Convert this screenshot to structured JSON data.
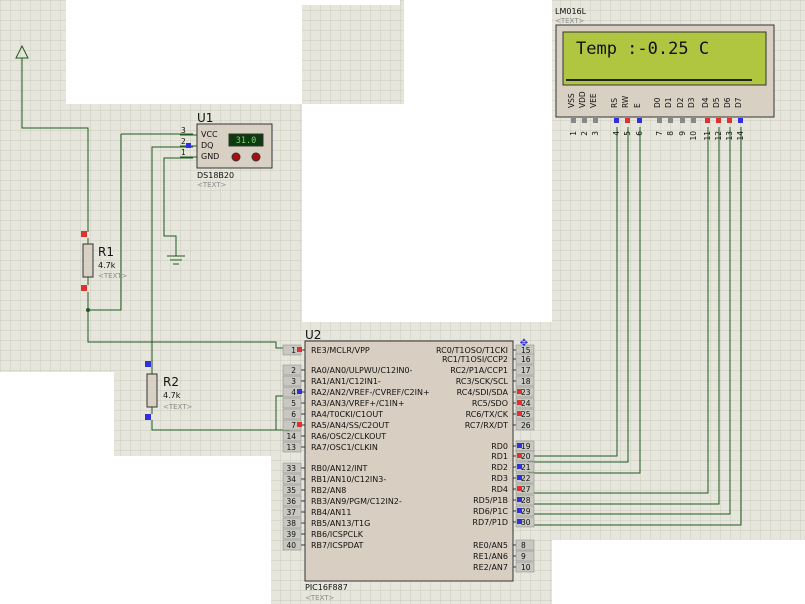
{
  "lcd": {
    "name": "LM016L",
    "placeholder": "<TEXT>",
    "display": "Temp :-0.25 C",
    "pin_labels": [
      "VSS",
      "VDD",
      "VEE",
      "RS",
      "RW",
      "E",
      "D0",
      "D1",
      "D2",
      "D3",
      "D4",
      "D5",
      "D6",
      "D7"
    ],
    "pin_numbers": [
      "1",
      "2",
      "3",
      "4",
      "5",
      "6",
      "7",
      "8",
      "9",
      "10",
      "11",
      "12",
      "13",
      "14"
    ]
  },
  "u1": {
    "ref": "U1",
    "part": "DS18B20",
    "placeholder": "<TEXT>",
    "reading": "31.0",
    "pins": [
      {
        "num": "3",
        "name": "VCC"
      },
      {
        "num": "2",
        "name": "DQ"
      },
      {
        "num": "1",
        "name": "GND"
      }
    ]
  },
  "r1": {
    "ref": "R1",
    "value": "4.7k",
    "placeholder": "<TEXT>"
  },
  "r2": {
    "ref": "R2",
    "value": "4.7k",
    "placeholder": "<TEXT>"
  },
  "u2": {
    "ref": "U2",
    "part": "PIC16F887",
    "placeholder": "<TEXT>",
    "left_pins": [
      {
        "num": "1",
        "name": "RE3/MCLR/VPP"
      },
      {
        "num": "2",
        "name": "RA0/AN0/ULPWU/C12IN0-"
      },
      {
        "num": "3",
        "name": "RA1/AN1/C12IN1-"
      },
      {
        "num": "4",
        "name": "RA2/AN2/VREF-/CVREF/C2IN+"
      },
      {
        "num": "5",
        "name": "RA3/AN3/VREF+/C1IN+"
      },
      {
        "num": "6",
        "name": "RA4/T0CKI/C1OUT"
      },
      {
        "num": "7",
        "name": "RA5/AN4/SS/C2OUT"
      },
      {
        "num": "14",
        "name": "RA6/OSC2/CLKOUT"
      },
      {
        "num": "13",
        "name": "RA7/OSC1/CLKIN"
      },
      {
        "num": "33",
        "name": "RB0/AN12/INT"
      },
      {
        "num": "34",
        "name": "RB1/AN10/C12IN3-"
      },
      {
        "num": "35",
        "name": "RB2/AN8"
      },
      {
        "num": "36",
        "name": "RB3/AN9/PGM/C12IN2-"
      },
      {
        "num": "37",
        "name": "RB4/AN11"
      },
      {
        "num": "38",
        "name": "RB5/AN13/T1G"
      },
      {
        "num": "39",
        "name": "RB6/ICSPCLK"
      },
      {
        "num": "40",
        "name": "RB7/ICSPDAT"
      }
    ],
    "right_pins": [
      {
        "num": "15",
        "name": "RC0/T1OSO/T1CKI"
      },
      {
        "num": "16",
        "name": "RC1/T1OSI/CCP2"
      },
      {
        "num": "17",
        "name": "RC2/P1A/CCP1"
      },
      {
        "num": "18",
        "name": "RC3/SCK/SCL"
      },
      {
        "num": "23",
        "name": "RC4/SDI/SDA"
      },
      {
        "num": "24",
        "name": "RC5/SDO"
      },
      {
        "num": "25",
        "name": "RC6/TX/CK"
      },
      {
        "num": "26",
        "name": "RC7/RX/DT"
      },
      {
        "num": "19",
        "name": "RD0"
      },
      {
        "num": "20",
        "name": "RD1"
      },
      {
        "num": "21",
        "name": "RD2"
      },
      {
        "num": "22",
        "name": "RD3"
      },
      {
        "num": "27",
        "name": "RD4"
      },
      {
        "num": "28",
        "name": "RD5/P1B"
      },
      {
        "num": "29",
        "name": "RD6/P1C"
      },
      {
        "num": "30",
        "name": "RD7/P1D"
      },
      {
        "num": "8",
        "name": "RE0/AN5"
      },
      {
        "num": "9",
        "name": "RE1/AN6"
      },
      {
        "num": "10",
        "name": "RE2/AN7"
      }
    ]
  },
  "colors": {
    "grid_bg": "#e6e6dc",
    "grid_line": "#c9c9bd",
    "wire": "#1f5a1f",
    "chip_fill": "#d8cfc2",
    "lcd_screen": "#b0c640",
    "pin_red": "#e03030",
    "pin_blue": "#3030e0"
  }
}
